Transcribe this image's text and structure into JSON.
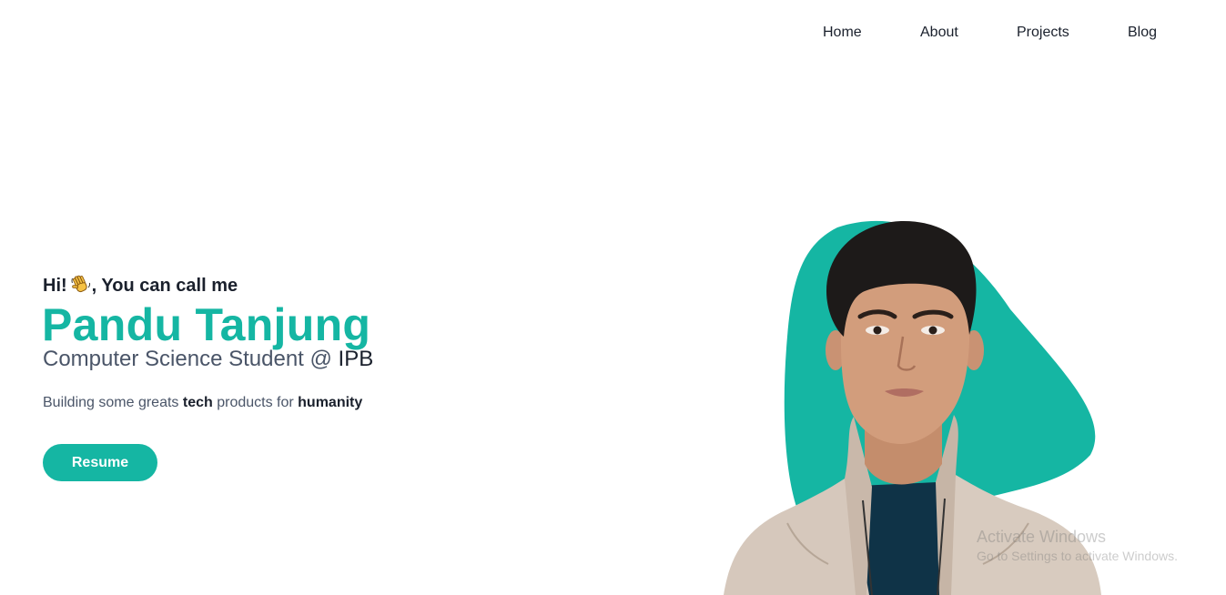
{
  "nav": {
    "items": [
      {
        "label": "Home"
      },
      {
        "label": "About"
      },
      {
        "label": "Projects"
      },
      {
        "label": "Blog"
      }
    ]
  },
  "hero": {
    "greeting_pre": "Hi!",
    "greeting_post": ", You can call me",
    "wave_icon": "waving-hand-icon",
    "name": "Pandu Tanjung",
    "role_prefix": "Computer Science Student @ ",
    "role_org": "IPB",
    "tagline_1": "Building some greats ",
    "tagline_bold_1": "tech",
    "tagline_2": " products for ",
    "tagline_bold_2": "humanity",
    "resume_label": "Resume"
  },
  "colors": {
    "accent": "#15b6a3",
    "text_dark": "#1a202c",
    "text_muted": "#4a5568"
  },
  "watermark": {
    "title": "Activate Windows",
    "subtitle": "Go to Settings to activate Windows."
  }
}
